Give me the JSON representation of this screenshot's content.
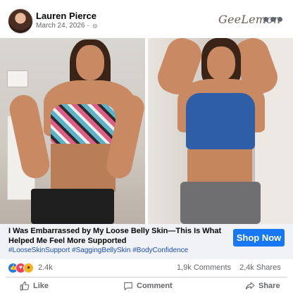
{
  "post": {
    "author": "Lauren Pierce",
    "date": "March 24, 2026",
    "brand": "GeeLemon",
    "title": "I Was Embarrassed by My Loose Belly Skin—This Is What Helped Me Feel More Supported",
    "hashtags": "#LooseSkinSupport #SaggingBellySkin #BodyConfidence",
    "cta_label": "Shop Now"
  },
  "icons": {
    "globe": "globe-icon",
    "more": "more-icon",
    "like": "like-icon",
    "comment": "comment-icon",
    "share": "share-icon"
  },
  "engagement": {
    "reaction_count": "2.4k",
    "comments": "1,9k Comments",
    "shares": "2,4k Shares"
  },
  "actions": {
    "like": "Like",
    "comment": "Comment",
    "share": "Share"
  },
  "colors": {
    "accent": "#1877f2",
    "caption_bg": "#f0f2f5",
    "hashtag": "#1b4fb0"
  }
}
